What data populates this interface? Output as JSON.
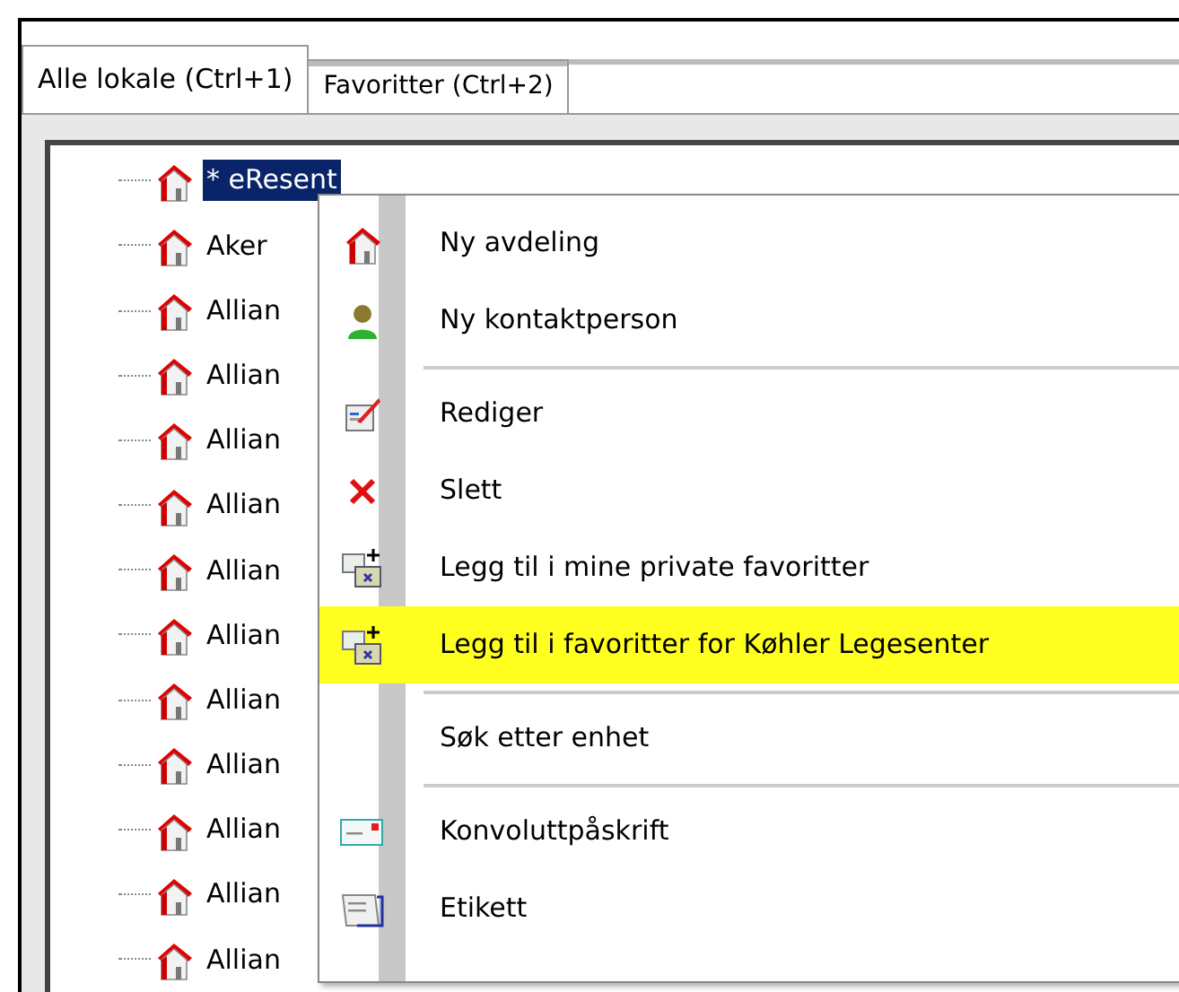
{
  "tabs": [
    {
      "label": "Alle lokale (Ctrl+1)",
      "selected": true
    },
    {
      "label": "Favoritter (Ctrl+2)",
      "selected": false
    }
  ],
  "tree": {
    "items": [
      {
        "label": "* eResent",
        "selected": true
      },
      {
        "label": "Aker",
        "selected": false
      },
      {
        "label": "Allian",
        "selected": false
      },
      {
        "label": "Allian",
        "selected": false
      },
      {
        "label": "Allian",
        "selected": false
      },
      {
        "label": "Allian",
        "selected": false
      },
      {
        "label": "Allian",
        "selected": false
      },
      {
        "label": "Allian",
        "selected": false
      },
      {
        "label": "Allian",
        "selected": false
      },
      {
        "label": "Allian",
        "selected": false
      },
      {
        "label": "Allian",
        "selected": false
      },
      {
        "label": "Allian",
        "selected": false
      },
      {
        "label": "Allian",
        "selected": false
      }
    ]
  },
  "context_menu": {
    "items": [
      {
        "kind": "item",
        "label": "Ny avdeling",
        "highlighted": false
      },
      {
        "kind": "item",
        "label": "Ny kontaktperson",
        "highlighted": false
      },
      {
        "kind": "separator"
      },
      {
        "kind": "item",
        "label": "Rediger",
        "highlighted": false
      },
      {
        "kind": "item",
        "label": "Slett",
        "highlighted": false
      },
      {
        "kind": "item",
        "label": "Legg til i mine private favoritter",
        "highlighted": false
      },
      {
        "kind": "item",
        "label": "Legg til i favoritter for Køhler Legesenter",
        "highlighted": true
      },
      {
        "kind": "separator"
      },
      {
        "kind": "item",
        "label": "Søk etter enhet",
        "highlighted": false
      },
      {
        "kind": "separator"
      },
      {
        "kind": "item",
        "label": "Konvoluttpåskrift",
        "highlighted": false
      },
      {
        "kind": "item",
        "label": "Etikett",
        "highlighted": false
      }
    ]
  }
}
